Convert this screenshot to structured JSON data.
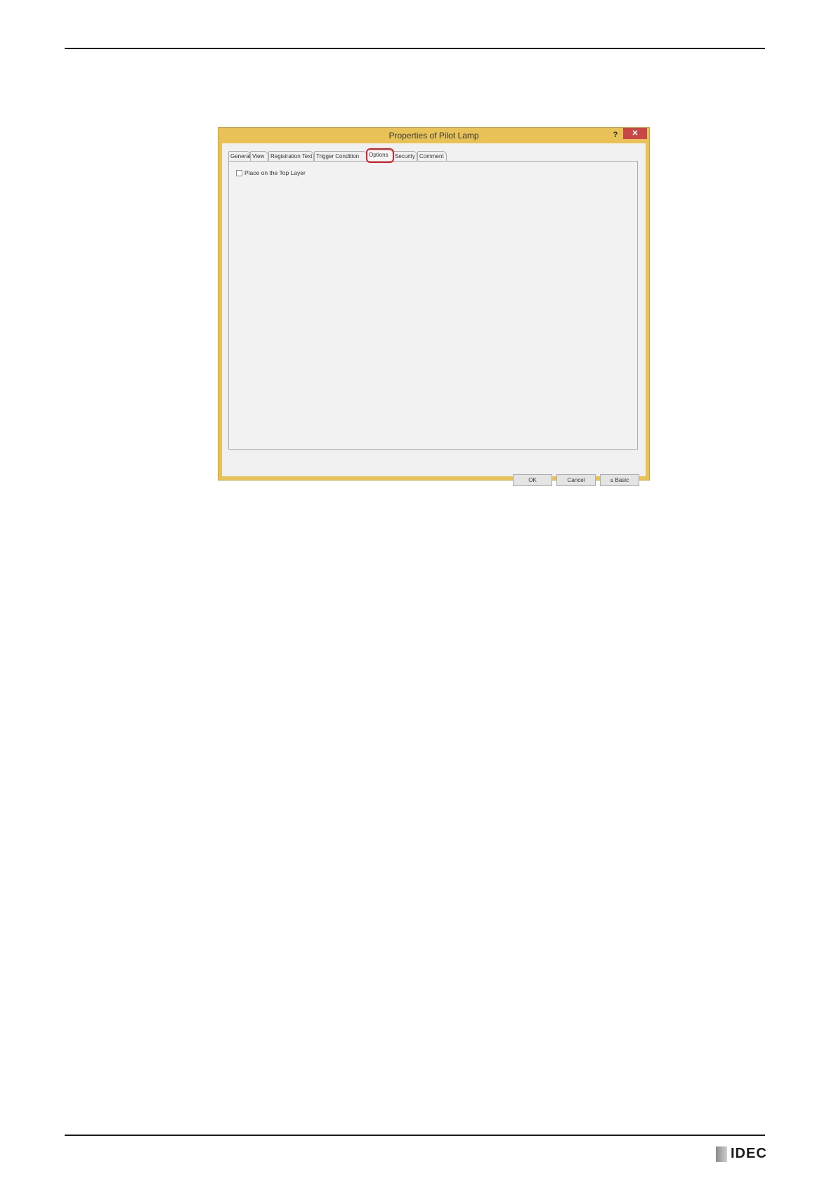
{
  "dialog": {
    "title": "Properties of Pilot Lamp",
    "help_label": "?",
    "close_label": "✕",
    "tabs": [
      {
        "label": "General"
      },
      {
        "label": "View"
      },
      {
        "label": "Registration Text"
      },
      {
        "label": "Trigger Condition"
      },
      {
        "label": "Options"
      },
      {
        "label": "Security"
      },
      {
        "label": "Comment"
      }
    ],
    "active_tab": "Options",
    "options_panel": {
      "place_on_top_layer": {
        "label": "Place on the Top Layer",
        "checked": false
      }
    },
    "buttons": {
      "ok": "OK",
      "cancel": "Cancel",
      "basic": "≤ Basic"
    }
  },
  "footer": {
    "logo_text": "IDEC"
  },
  "colors": {
    "frame": "#e8c257",
    "close": "#c84848",
    "highlight": "#e0202a"
  }
}
